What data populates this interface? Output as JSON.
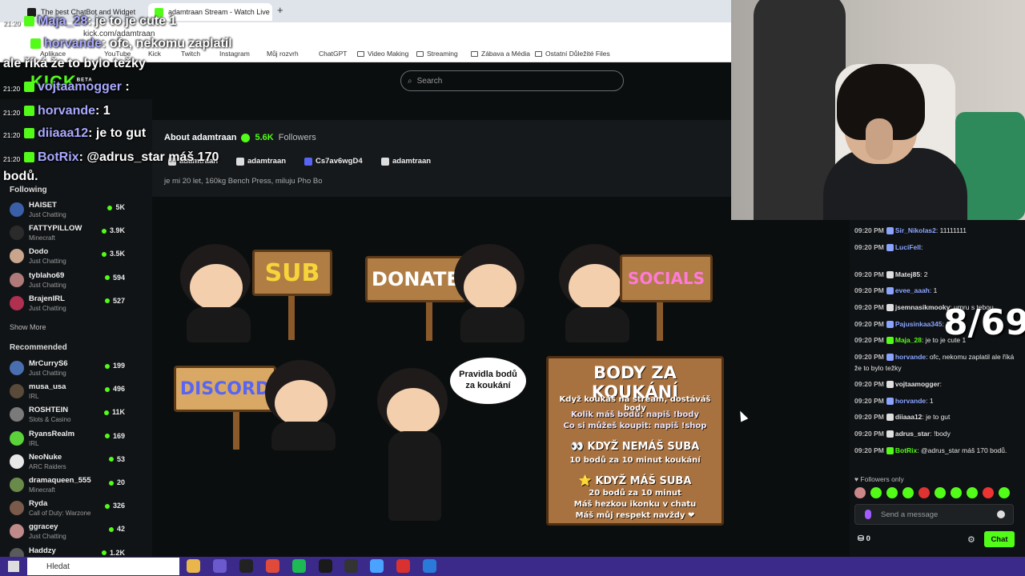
{
  "browser": {
    "tabs": [
      {
        "label": "The best ChatBot and Widget"
      },
      {
        "label": "adamtraan Stream - Watch Live"
      }
    ],
    "url": "kick.com/adamtraan",
    "bookmarks": [
      "Aplikace",
      "YouTube",
      "Kick",
      "Twitch",
      "Instagram",
      "Můj rozvrh",
      "ChatGPT",
      "Video Making",
      "Streaming",
      "Zábava a Média",
      "Ostatní Důležité Files"
    ]
  },
  "kick": {
    "logo": "KICK",
    "logo_sup": "BETA",
    "search_placeholder": "Search"
  },
  "sidebar": {
    "following_label": "Following",
    "following": [
      {
        "name": "HAISET",
        "category": "Just Chatting",
        "viewers": "5K",
        "color": "#3a5ea8"
      },
      {
        "name": "FATTYPILLOW",
        "category": "Minecraft",
        "viewers": "3.9K",
        "color": "#2b2b2b"
      },
      {
        "name": "Dodo",
        "category": "Just Chatting",
        "viewers": "3.5K",
        "color": "#c9a58d"
      },
      {
        "name": "tyblaho69",
        "category": "Just Chatting",
        "viewers": "594",
        "color": "#b07a7a"
      },
      {
        "name": "BrajenIRL",
        "category": "Just Chatting",
        "viewers": "527",
        "color": "#b03050"
      }
    ],
    "show_more": "Show More",
    "recommended_label": "Recommended",
    "recommended": [
      {
        "name": "MrCurryS6",
        "category": "Just Chatting",
        "viewers": "199",
        "color": "#4a6fb0"
      },
      {
        "name": "musa_usa",
        "category": "IRL",
        "viewers": "496",
        "color": "#5a4a3a"
      },
      {
        "name": "ROSHTEIN",
        "category": "Slots & Casino",
        "viewers": "11K",
        "color": "#7a7a7a"
      },
      {
        "name": "RyansRealm",
        "category": "IRL",
        "viewers": "169",
        "color": "#5bd13a"
      },
      {
        "name": "NeoNuke",
        "category": "ARC Raiders",
        "viewers": "53",
        "color": "#e8e8e8"
      },
      {
        "name": "dramaqueen_555",
        "category": "Minecraft",
        "viewers": "20",
        "color": "#6a8a4a"
      },
      {
        "name": "Ryda",
        "category": "Call of Duty: Warzone",
        "viewers": "326",
        "color": "#7a5a4a"
      },
      {
        "name": "ggracey",
        "category": "Just Chatting",
        "viewers": "42",
        "color": "#c08a8a"
      },
      {
        "name": "Haddzy",
        "category": "",
        "viewers": "1.2K",
        "color": "#5a5a5a"
      }
    ]
  },
  "about": {
    "title": "About adamtraan",
    "followers": "5.6K",
    "followers_label": "Followers",
    "socials": [
      "adamtraan",
      "adamtraan",
      "Cs7av6wgD4",
      "adamtraan"
    ],
    "bio": "je mi 20 let, 160kg Bench Press, miluju Pho Bo"
  },
  "panels": {
    "sub": "SUB",
    "donate": "DONATE",
    "socials": "SOCIALS",
    "discord": "DISCORD",
    "bubble": "Pravidla bodů za koukání",
    "board": {
      "title": "BODY ZA KOUKÁNÍ",
      "lines": [
        "Když koukáš na stream, dostáváš body",
        "Kolik máš bodů: napiš !body",
        "Co si můžeš koupit: napiš !shop",
        "👀 KDYŽ NEMÁŠ SUBA",
        "10 bodů za 10 minut koukání",
        "⭐ KDYŽ MÁŠ SUBA",
        "20 bodů za 10 minut",
        "Máš hezkou ikonku v chatu",
        "Máš můj respekt navždy ❤"
      ]
    }
  },
  "chat": {
    "messages": [
      {
        "time": "09:20 PM",
        "user": "Sir_Nikolas2",
        "text": "11111111",
        "color": "#8aa4ff"
      },
      {
        "time": "09:20 PM",
        "user": "LuciFell",
        "text": "",
        "color": "#8aa4ff"
      },
      {
        "time": "09:20 PM",
        "user": "Matej85",
        "text": "2",
        "color": "#e0e0e0"
      },
      {
        "time": "09:20 PM",
        "user": "evee_aaah",
        "text": "1",
        "color": "#8aa4ff"
      },
      {
        "time": "09:20 PM",
        "user": "jsemnasikmooky",
        "text": "umru s tebou",
        "color": "#e0e0e0"
      },
      {
        "time": "09:20 PM",
        "user": "Pajusinkaa345",
        "text": "1",
        "color": "#8aa4ff"
      },
      {
        "time": "09:20 PM",
        "user": "Maja_28",
        "text": "je to je cute 1",
        "color": "#53fc18"
      },
      {
        "time": "09:20 PM",
        "user": "horvande",
        "text": "ofc, nekomu zaplatil ale říká že to bylo težky",
        "color": "#8aa4ff"
      },
      {
        "time": "09:20 PM",
        "user": "vojtaamogger",
        "text": "",
        "color": "#e0e0e0"
      },
      {
        "time": "09:20 PM",
        "user": "horvande",
        "text": "1",
        "color": "#8aa4ff"
      },
      {
        "time": "09:20 PM",
        "user": "diiaaa12",
        "text": "je to gut",
        "color": "#e0e0e0"
      },
      {
        "time": "09:20 PM",
        "user": "adrus_star",
        "text": "!body",
        "color": "#e0e0e0"
      },
      {
        "time": "09:20 PM",
        "user": "BotRix",
        "text": "@adrus_star máš 170 bodů.",
        "color": "#53fc18"
      }
    ],
    "followers_only": "Followers only",
    "input_placeholder": "Send a message",
    "points": "0",
    "send_label": "Chat"
  },
  "counter": "8/69",
  "overlay": {
    "lines": [
      {
        "time": "21:20",
        "user": "Maja_28",
        "text": ": je to je cute 1"
      },
      {
        "time": "",
        "user": "horvande",
        "text": ": ofc, nekomu zaplatil"
      },
      {
        "time": "",
        "user": "",
        "text": "ale říká že to bylo težky"
      },
      {
        "time": "21:20",
        "user": "vojtaamogger",
        "text": " :"
      },
      {
        "time": "21:20",
        "user": "horvande",
        "text": ": 1"
      },
      {
        "time": "21:20",
        "user": "diiaaa12",
        "text": ": je to gut"
      },
      {
        "time": "21:20",
        "user": "BotRix",
        "text": ": @adrus_star máš 170"
      },
      {
        "time": "",
        "user": "",
        "text": "bodů."
      }
    ]
  },
  "taskbar": {
    "search_placeholder": "Hledat"
  },
  "colors": {
    "accent": "#53fc18",
    "taskbar": "#3b2a8a"
  }
}
